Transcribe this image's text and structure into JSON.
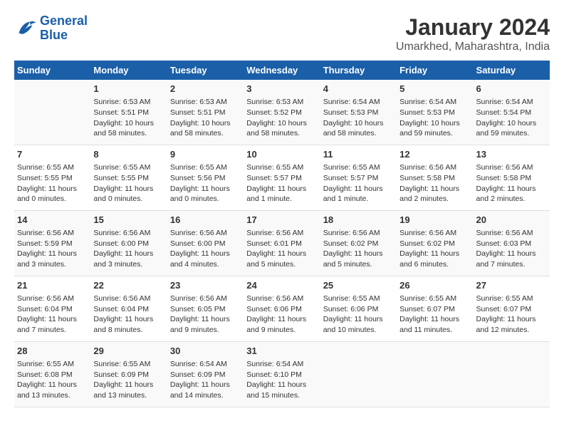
{
  "logo": {
    "line1": "General",
    "line2": "Blue"
  },
  "title": "January 2024",
  "subtitle": "Umarkhed, Maharashtra, India",
  "weekdays": [
    "Sunday",
    "Monday",
    "Tuesday",
    "Wednesday",
    "Thursday",
    "Friday",
    "Saturday"
  ],
  "weeks": [
    [
      {
        "day": "",
        "lines": []
      },
      {
        "day": "1",
        "lines": [
          "Sunrise: 6:53 AM",
          "Sunset: 5:51 PM",
          "Daylight: 10 hours",
          "and 58 minutes."
        ]
      },
      {
        "day": "2",
        "lines": [
          "Sunrise: 6:53 AM",
          "Sunset: 5:51 PM",
          "Daylight: 10 hours",
          "and 58 minutes."
        ]
      },
      {
        "day": "3",
        "lines": [
          "Sunrise: 6:53 AM",
          "Sunset: 5:52 PM",
          "Daylight: 10 hours",
          "and 58 minutes."
        ]
      },
      {
        "day": "4",
        "lines": [
          "Sunrise: 6:54 AM",
          "Sunset: 5:53 PM",
          "Daylight: 10 hours",
          "and 58 minutes."
        ]
      },
      {
        "day": "5",
        "lines": [
          "Sunrise: 6:54 AM",
          "Sunset: 5:53 PM",
          "Daylight: 10 hours",
          "and 59 minutes."
        ]
      },
      {
        "day": "6",
        "lines": [
          "Sunrise: 6:54 AM",
          "Sunset: 5:54 PM",
          "Daylight: 10 hours",
          "and 59 minutes."
        ]
      }
    ],
    [
      {
        "day": "7",
        "lines": [
          "Sunrise: 6:55 AM",
          "Sunset: 5:55 PM",
          "Daylight: 11 hours",
          "and 0 minutes."
        ]
      },
      {
        "day": "8",
        "lines": [
          "Sunrise: 6:55 AM",
          "Sunset: 5:55 PM",
          "Daylight: 11 hours",
          "and 0 minutes."
        ]
      },
      {
        "day": "9",
        "lines": [
          "Sunrise: 6:55 AM",
          "Sunset: 5:56 PM",
          "Daylight: 11 hours",
          "and 0 minutes."
        ]
      },
      {
        "day": "10",
        "lines": [
          "Sunrise: 6:55 AM",
          "Sunset: 5:57 PM",
          "Daylight: 11 hours",
          "and 1 minute."
        ]
      },
      {
        "day": "11",
        "lines": [
          "Sunrise: 6:55 AM",
          "Sunset: 5:57 PM",
          "Daylight: 11 hours",
          "and 1 minute."
        ]
      },
      {
        "day": "12",
        "lines": [
          "Sunrise: 6:56 AM",
          "Sunset: 5:58 PM",
          "Daylight: 11 hours",
          "and 2 minutes."
        ]
      },
      {
        "day": "13",
        "lines": [
          "Sunrise: 6:56 AM",
          "Sunset: 5:58 PM",
          "Daylight: 11 hours",
          "and 2 minutes."
        ]
      }
    ],
    [
      {
        "day": "14",
        "lines": [
          "Sunrise: 6:56 AM",
          "Sunset: 5:59 PM",
          "Daylight: 11 hours",
          "and 3 minutes."
        ]
      },
      {
        "day": "15",
        "lines": [
          "Sunrise: 6:56 AM",
          "Sunset: 6:00 PM",
          "Daylight: 11 hours",
          "and 3 minutes."
        ]
      },
      {
        "day": "16",
        "lines": [
          "Sunrise: 6:56 AM",
          "Sunset: 6:00 PM",
          "Daylight: 11 hours",
          "and 4 minutes."
        ]
      },
      {
        "day": "17",
        "lines": [
          "Sunrise: 6:56 AM",
          "Sunset: 6:01 PM",
          "Daylight: 11 hours",
          "and 5 minutes."
        ]
      },
      {
        "day": "18",
        "lines": [
          "Sunrise: 6:56 AM",
          "Sunset: 6:02 PM",
          "Daylight: 11 hours",
          "and 5 minutes."
        ]
      },
      {
        "day": "19",
        "lines": [
          "Sunrise: 6:56 AM",
          "Sunset: 6:02 PM",
          "Daylight: 11 hours",
          "and 6 minutes."
        ]
      },
      {
        "day": "20",
        "lines": [
          "Sunrise: 6:56 AM",
          "Sunset: 6:03 PM",
          "Daylight: 11 hours",
          "and 7 minutes."
        ]
      }
    ],
    [
      {
        "day": "21",
        "lines": [
          "Sunrise: 6:56 AM",
          "Sunset: 6:04 PM",
          "Daylight: 11 hours",
          "and 7 minutes."
        ]
      },
      {
        "day": "22",
        "lines": [
          "Sunrise: 6:56 AM",
          "Sunset: 6:04 PM",
          "Daylight: 11 hours",
          "and 8 minutes."
        ]
      },
      {
        "day": "23",
        "lines": [
          "Sunrise: 6:56 AM",
          "Sunset: 6:05 PM",
          "Daylight: 11 hours",
          "and 9 minutes."
        ]
      },
      {
        "day": "24",
        "lines": [
          "Sunrise: 6:56 AM",
          "Sunset: 6:06 PM",
          "Daylight: 11 hours",
          "and 9 minutes."
        ]
      },
      {
        "day": "25",
        "lines": [
          "Sunrise: 6:55 AM",
          "Sunset: 6:06 PM",
          "Daylight: 11 hours",
          "and 10 minutes."
        ]
      },
      {
        "day": "26",
        "lines": [
          "Sunrise: 6:55 AM",
          "Sunset: 6:07 PM",
          "Daylight: 11 hours",
          "and 11 minutes."
        ]
      },
      {
        "day": "27",
        "lines": [
          "Sunrise: 6:55 AM",
          "Sunset: 6:07 PM",
          "Daylight: 11 hours",
          "and 12 minutes."
        ]
      }
    ],
    [
      {
        "day": "28",
        "lines": [
          "Sunrise: 6:55 AM",
          "Sunset: 6:08 PM",
          "Daylight: 11 hours",
          "and 13 minutes."
        ]
      },
      {
        "day": "29",
        "lines": [
          "Sunrise: 6:55 AM",
          "Sunset: 6:09 PM",
          "Daylight: 11 hours",
          "and 13 minutes."
        ]
      },
      {
        "day": "30",
        "lines": [
          "Sunrise: 6:54 AM",
          "Sunset: 6:09 PM",
          "Daylight: 11 hours",
          "and 14 minutes."
        ]
      },
      {
        "day": "31",
        "lines": [
          "Sunrise: 6:54 AM",
          "Sunset: 6:10 PM",
          "Daylight: 11 hours",
          "and 15 minutes."
        ]
      },
      {
        "day": "",
        "lines": []
      },
      {
        "day": "",
        "lines": []
      },
      {
        "day": "",
        "lines": []
      }
    ]
  ]
}
